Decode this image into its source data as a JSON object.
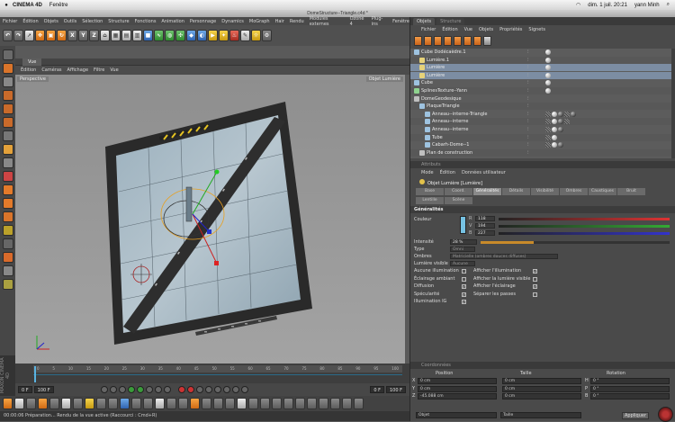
{
  "mac": {
    "app": "CINEMA 4D",
    "menus": [
      "Fenêtre"
    ],
    "clock": "dim. 1 juil. 20:21",
    "user": "yann Minh"
  },
  "window_title": "DomeStructure--Triangle.c4d *",
  "main_menus": [
    "Fichier",
    "Édition",
    "Objets",
    "Outils",
    "Sélection",
    "Structure",
    "Fonctions",
    "Animation",
    "Personnage",
    "Dynamics",
    "MoGraph",
    "Hair",
    "Rendu",
    "Modules externes",
    "Ozone 4",
    "Plug-ins",
    "Fenêtre"
  ],
  "toolbar": {
    "axis_x": "X",
    "axis_y": "Y",
    "axis_z": "Z"
  },
  "view": {
    "tab": "Vue",
    "menus": [
      "Édition",
      "Caméras",
      "Affichage",
      "Filtre",
      "Vue"
    ],
    "label_left": "Perspective",
    "label_right_1": "Objet",
    "label_right_2": "Lumière"
  },
  "timeline": {
    "ticks": [
      "0",
      "5",
      "10",
      "15",
      "20",
      "25",
      "30",
      "35",
      "40",
      "45",
      "50",
      "55",
      "60",
      "65",
      "70",
      "75",
      "80",
      "85",
      "90",
      "95",
      "100"
    ],
    "start_field": "0 F",
    "end_field": "100 F",
    "current_field": "0 F",
    "max_field": "100 F"
  },
  "status": "00:00:06 Préparation...     Rendu de la vue active (Raccourci : Cmd+R)",
  "side_brand": "MAXON CINEMA 4D",
  "objects_panel": {
    "tabs": [
      "Objets",
      "Structure"
    ],
    "menus": [
      "Fichier",
      "Édition",
      "Vue",
      "Objets",
      "Propriétés",
      "Signets"
    ],
    "rows": [
      {
        "name": "Cube Dodécaèdre.1",
        "indent": 0,
        "sel": false
      },
      {
        "name": "Lumière.1",
        "indent": 1,
        "sel": false
      },
      {
        "name": "Lumière",
        "indent": 1,
        "sel": true
      },
      {
        "name": "Lumière",
        "indent": 1,
        "sel": true
      },
      {
        "name": "Cube",
        "indent": 0,
        "sel": false
      },
      {
        "name": "SplinesTexture--Yann",
        "indent": 0,
        "sel": false
      },
      {
        "name": "DomeGeodesique",
        "indent": 0,
        "sel": false
      },
      {
        "name": "PlaqueTriangle",
        "indent": 1,
        "sel": false
      },
      {
        "name": "Anneau--interne-Triangle",
        "indent": 2,
        "sel": false
      },
      {
        "name": "Anneau--interne",
        "indent": 2,
        "sel": false
      },
      {
        "name": "Anneau--interne",
        "indent": 2,
        "sel": false
      },
      {
        "name": "Tube",
        "indent": 2,
        "sel": false
      },
      {
        "name": "Cabarh-Dome--1",
        "indent": 2,
        "sel": false
      },
      {
        "name": "Plan de construction",
        "indent": 1,
        "sel": false
      }
    ]
  },
  "attributes_panel": {
    "header": "Attributs",
    "menus": [
      "Mode",
      "Édition",
      "Données utilisateur"
    ],
    "title": "Objet Lumière [Lumière]",
    "tabs": [
      "Base",
      "Coord.",
      "Généralités",
      "Détails",
      "Visibilité",
      "Ombres",
      "Caustiques",
      "Bruit",
      "Lentille",
      "Scène"
    ],
    "active_tab": "Généralités",
    "section": "Généralités",
    "color_label": "Couleur",
    "color_values": {
      "r": "118",
      "g": "194",
      "b": "227"
    },
    "color_hex": "#76c2e3",
    "rows": {
      "intensity_label": "Intensité",
      "intensity_value": "28 %",
      "type_label": "Type",
      "type_value": "Omni",
      "shadows_label": "Ombres",
      "shadows_value": "Matricielle (ombres douces diffuses)",
      "visible_label": "Lumière visible",
      "visible_value": "Aucune"
    },
    "checks": [
      {
        "label": "Aucune illumination",
        "checked": false,
        "label2": "Afficher l'illumination",
        "checked2": true
      },
      {
        "label": "Éclairage ambiant",
        "checked": false,
        "label2": "Afficher la lumière visible",
        "checked2": false
      },
      {
        "label": "Diffusion",
        "checked": true,
        "label2": "Afficher l'éclairage",
        "checked2": true
      },
      {
        "label": "Spécularité",
        "checked": true,
        "label2": "Séparer les passes",
        "checked2": false
      },
      {
        "label": "Illumination IG",
        "checked": true
      }
    ]
  },
  "coordinates_panel": {
    "header": "Coordonnées",
    "col_position": "Position",
    "col_size": "Taille",
    "col_rotation": "Rotation",
    "rows": [
      {
        "axis": "X",
        "pos": "0 cm",
        "size": "0 cm",
        "rot": "0 °",
        "rot_label": "H"
      },
      {
        "axis": "Y",
        "pos": "0 cm",
        "size": "0 cm",
        "rot": "0 °",
        "rot_label": "P"
      },
      {
        "axis": "Z",
        "pos": "-45.088 cm",
        "size": "0 cm",
        "rot": "0 °",
        "rot_label": "B"
      }
    ],
    "mode_left": "Objet",
    "mode_mid": "Taille",
    "apply": "Appliquer"
  }
}
